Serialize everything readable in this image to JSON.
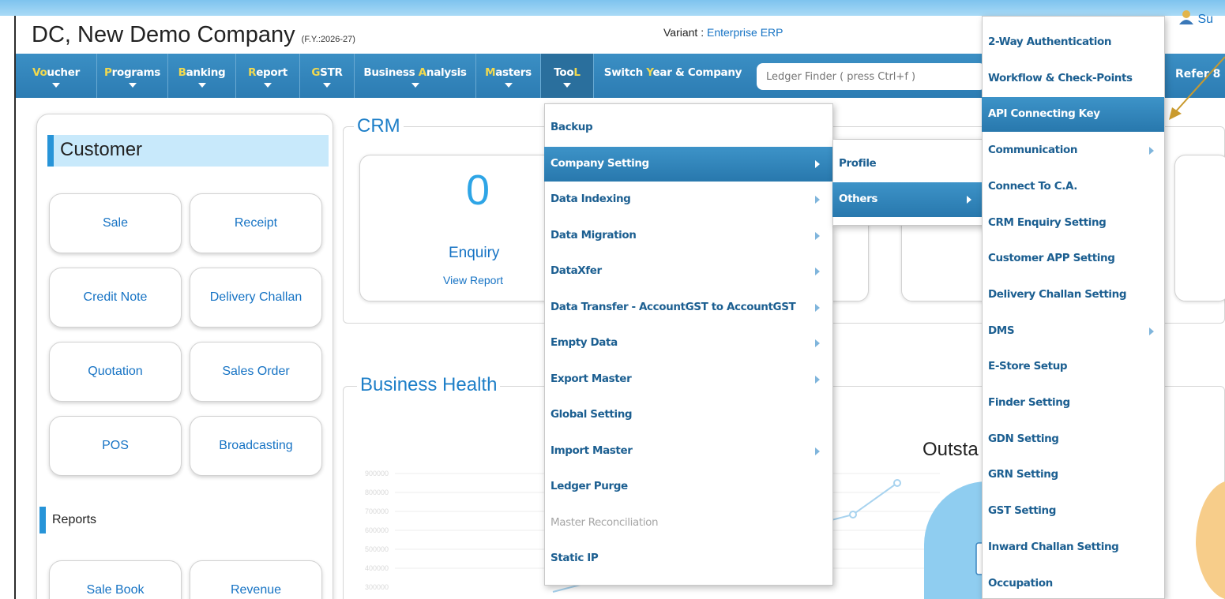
{
  "header": {
    "company": "DC, New Demo Company",
    "fy": "(F.Y.:2026-27)",
    "variant_label": "Variant : ",
    "variant_value": "Enterprise ERP",
    "user": "Su"
  },
  "nav": {
    "items": [
      {
        "hl": "Vo",
        "rest": "ucher"
      },
      {
        "hl": "P",
        "rest": "rograms"
      },
      {
        "hl": "B",
        "rest": "anking"
      },
      {
        "hl": "R",
        "rest": "eport"
      },
      {
        "hl": "G",
        "rest": "STR"
      },
      {
        "pre": "Business ",
        "hl": "A",
        "rest": "nalysis"
      },
      {
        "hl": "M",
        "rest": "asters"
      },
      {
        "pre": "Too",
        "hl": "L",
        "rest": ""
      },
      {
        "pre": "Switch ",
        "hl": "Y",
        "rest": "ear & Company"
      }
    ],
    "ledger_placeholder": "Ledger Finder ( press Ctrl+f )",
    "refer": "Refer 8"
  },
  "customer": {
    "title": "Customer",
    "tiles": [
      "Sale",
      "Receipt",
      "Credit Note",
      "Delivery Challan",
      "Quotation",
      "Sales Order",
      "POS",
      "Broadcasting"
    ],
    "reports_title": "Reports",
    "report_tiles": [
      "Sale Book",
      "Revenue"
    ]
  },
  "crm": {
    "legend": "CRM",
    "count": "0",
    "label": "Enquiry",
    "link": "View Report"
  },
  "health": {
    "legend": "Business Health",
    "outstanding": "Outsta",
    "y_ticks": [
      "900000",
      "800000",
      "700000",
      "600000",
      "500000",
      "400000",
      "300000"
    ]
  },
  "tool_menu": {
    "items": [
      {
        "label": "Backup",
        "submenu": false
      },
      {
        "label": "Company Setting",
        "submenu": true
      },
      {
        "label": "Data Indexing",
        "submenu": true
      },
      {
        "label": "Data Migration",
        "submenu": true
      },
      {
        "label": "DataXfer",
        "submenu": true
      },
      {
        "label": "Data Transfer - AccountGST to AccountGST",
        "submenu": true
      },
      {
        "label": "Empty Data",
        "submenu": true
      },
      {
        "label": "Export Master",
        "submenu": true
      },
      {
        "label": "Global Setting",
        "submenu": false
      },
      {
        "label": "Import Master",
        "submenu": true
      },
      {
        "label": "Ledger Purge",
        "submenu": false
      },
      {
        "label": "Master Reconciliation",
        "submenu": false
      },
      {
        "label": "Static IP",
        "submenu": false
      }
    ]
  },
  "company_setting_menu": {
    "items": [
      {
        "label": "Profile",
        "submenu": false
      },
      {
        "label": "Others",
        "submenu": true
      }
    ]
  },
  "others_menu": {
    "items": [
      {
        "label": "2-Way Authentication",
        "submenu": false
      },
      {
        "label": "Workflow & Check-Points",
        "submenu": false
      },
      {
        "label": "API Connecting Key",
        "submenu": false
      },
      {
        "label": "Communication",
        "submenu": true
      },
      {
        "label": "Connect To C.A.",
        "submenu": false
      },
      {
        "label": "CRM Enquiry Setting",
        "submenu": false
      },
      {
        "label": "Customer APP Setting",
        "submenu": false
      },
      {
        "label": "Delivery Challan Setting",
        "submenu": false
      },
      {
        "label": "DMS",
        "submenu": true
      },
      {
        "label": "E-Store Setup",
        "submenu": false
      },
      {
        "label": "Finder Setting",
        "submenu": false
      },
      {
        "label": "GDN Setting",
        "submenu": false
      },
      {
        "label": "GRN Setting",
        "submenu": false
      },
      {
        "label": "GST Setting",
        "submenu": false
      },
      {
        "label": "Inward Challan Setting",
        "submenu": false
      },
      {
        "label": "Occupation",
        "submenu": false
      }
    ]
  },
  "colors": {
    "nav_bg": "#3b8fc4",
    "menu_highlight": "#2d7fb6",
    "link_blue": "#1673c4",
    "nav_hotkey": "#f2d94e",
    "annotation_arrow": "#c99a2e"
  }
}
